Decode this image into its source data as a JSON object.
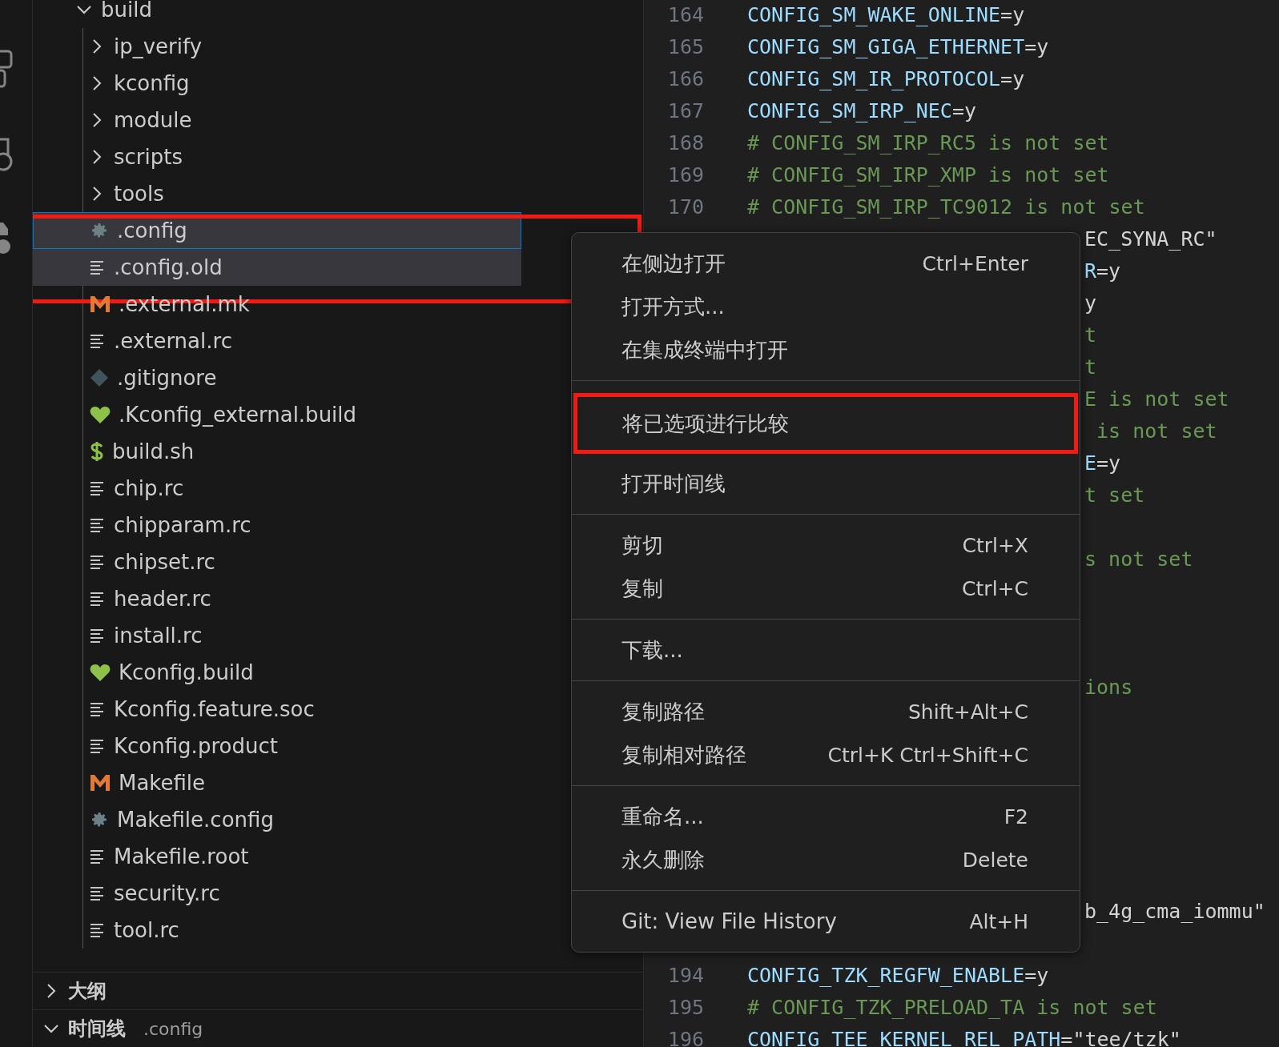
{
  "explorer": {
    "tree": [
      {
        "name": "build",
        "kind": "folder",
        "expanded": true,
        "selected": false,
        "focused": false,
        "children": [
          {
            "name": "ip_verify",
            "kind": "folder",
            "expanded": false,
            "selected": false,
            "focused": false
          },
          {
            "name": "kconfig",
            "kind": "folder",
            "expanded": false,
            "selected": false,
            "focused": false
          },
          {
            "name": "module",
            "kind": "folder",
            "expanded": false,
            "selected": false,
            "focused": false
          },
          {
            "name": "scripts",
            "kind": "folder",
            "expanded": false,
            "selected": false,
            "focused": false
          },
          {
            "name": "tools",
            "kind": "folder",
            "expanded": false,
            "selected": false,
            "focused": false
          },
          {
            "name": ".config",
            "kind": "settings",
            "selected": true,
            "focused": true,
            "marked": true
          },
          {
            "name": ".config.old",
            "kind": "text",
            "selected": true,
            "focused": false,
            "marked": true
          },
          {
            "name": ".external.mk",
            "kind": "makefile",
            "selected": false,
            "focused": false,
            "marked": false
          },
          {
            "name": ".external.rc",
            "kind": "text",
            "selected": false,
            "focused": false,
            "marked": false
          },
          {
            "name": ".gitignore",
            "kind": "git",
            "selected": false,
            "focused": false,
            "marked": false
          },
          {
            "name": ".Kconfig_external.build",
            "kind": "kconfig",
            "selected": false,
            "focused": false,
            "marked": false
          },
          {
            "name": "build.sh",
            "kind": "shell",
            "selected": false,
            "focused": false,
            "marked": false
          },
          {
            "name": "chip.rc",
            "kind": "text",
            "selected": false,
            "focused": false,
            "marked": false
          },
          {
            "name": "chipparam.rc",
            "kind": "text",
            "selected": false,
            "focused": false,
            "marked": false
          },
          {
            "name": "chipset.rc",
            "kind": "text",
            "selected": false,
            "focused": false,
            "marked": false
          },
          {
            "name": "header.rc",
            "kind": "text",
            "selected": false,
            "focused": false,
            "marked": false
          },
          {
            "name": "install.rc",
            "kind": "text",
            "selected": false,
            "focused": false,
            "marked": false
          },
          {
            "name": "Kconfig.build",
            "kind": "kconfig",
            "selected": false,
            "focused": false,
            "marked": false
          },
          {
            "name": "Kconfig.feature.soc",
            "kind": "text",
            "selected": false,
            "focused": false,
            "marked": false
          },
          {
            "name": "Kconfig.product",
            "kind": "text",
            "selected": false,
            "focused": false,
            "marked": false
          },
          {
            "name": "Makefile",
            "kind": "makefile",
            "selected": false,
            "focused": false,
            "marked": false
          },
          {
            "name": "Makefile.config",
            "kind": "settings",
            "selected": false,
            "focused": false,
            "marked": false
          },
          {
            "name": "Makefile.root",
            "kind": "text",
            "selected": false,
            "focused": false,
            "marked": false
          },
          {
            "name": "security.rc",
            "kind": "text",
            "selected": false,
            "focused": false,
            "marked": false
          },
          {
            "name": "tool.rc",
            "kind": "text",
            "selected": false,
            "focused": false,
            "marked": false
          }
        ]
      }
    ],
    "panels": [
      {
        "title": "大纲",
        "expanded": false
      },
      {
        "title": "时间线",
        "expanded": true,
        "description": ".config"
      }
    ]
  },
  "editor": {
    "lines": [
      {
        "kind": "full",
        "number": "164",
        "segments": [
          {
            "kind": "key",
            "text": "CONFIG_SM_WAKE_ONLINE"
          },
          {
            "kind": "value",
            "text": "=y"
          }
        ]
      },
      {
        "kind": "full",
        "number": "165",
        "segments": [
          {
            "kind": "key",
            "text": "CONFIG_SM_GIGA_ETHERNET"
          },
          {
            "kind": "value",
            "text": "=y"
          }
        ]
      },
      {
        "kind": "full",
        "number": "166",
        "segments": [
          {
            "kind": "key",
            "text": "CONFIG_SM_IR_PROTOCOL"
          },
          {
            "kind": "value",
            "text": "=y"
          }
        ]
      },
      {
        "kind": "full",
        "number": "167",
        "segments": [
          {
            "kind": "key",
            "text": "CONFIG_SM_IRP_NEC"
          },
          {
            "kind": "value",
            "text": "=y"
          }
        ]
      },
      {
        "kind": "full",
        "number": "168",
        "segments": [
          {
            "kind": "comment",
            "text": "# CONFIG_SM_IRP_RC5 is not set"
          }
        ]
      },
      {
        "kind": "full",
        "number": "169",
        "segments": [
          {
            "kind": "comment",
            "text": "# CONFIG_SM_IRP_XMP is not set"
          }
        ]
      },
      {
        "kind": "full",
        "number": "170",
        "segments": [
          {
            "kind": "comment",
            "text": "# CONFIG_SM_IRP_TC9012 is not set"
          }
        ]
      },
      {
        "kind": "partial",
        "segments": [
          {
            "kind": "value",
            "text": "EC_SYNA_RC\""
          }
        ]
      },
      {
        "kind": "partial",
        "segments": [
          {
            "kind": "key",
            "text": "R"
          },
          {
            "kind": "value",
            "text": "=y"
          }
        ]
      },
      {
        "kind": "partial",
        "segments": [
          {
            "kind": "value",
            "text": "y"
          }
        ]
      },
      {
        "kind": "partial",
        "segments": [
          {
            "kind": "comment",
            "text": "t"
          }
        ]
      },
      {
        "kind": "partial",
        "segments": [
          {
            "kind": "comment",
            "text": "t"
          }
        ]
      },
      {
        "kind": "partial",
        "segments": [
          {
            "kind": "comment",
            "text": "E is not set"
          }
        ]
      },
      {
        "kind": "partial",
        "segments": [
          {
            "kind": "comment",
            "text": " is not set"
          }
        ]
      },
      {
        "kind": "partial",
        "segments": [
          {
            "kind": "key",
            "text": "E"
          },
          {
            "kind": "value",
            "text": "=y"
          }
        ]
      },
      {
        "kind": "partial",
        "segments": [
          {
            "kind": "comment",
            "text": "t set"
          }
        ]
      },
      {
        "kind": "partial"
      },
      {
        "kind": "partial",
        "segments": [
          {
            "kind": "comment",
            "text": "s not set"
          }
        ]
      },
      {
        "kind": "partial"
      },
      {
        "kind": "partial"
      },
      {
        "kind": "partial"
      },
      {
        "kind": "partial",
        "segments": [
          {
            "kind": "comment",
            "text": "ions"
          }
        ]
      },
      {
        "kind": "partial"
      },
      {
        "kind": "partial"
      },
      {
        "kind": "partial"
      },
      {
        "kind": "partial"
      },
      {
        "kind": "partial"
      },
      {
        "kind": "partial"
      },
      {
        "kind": "partial",
        "segments": [
          {
            "kind": "value",
            "text": "b_4g_cma_iommu\""
          }
        ]
      },
      {
        "kind": "partial"
      },
      {
        "kind": "full",
        "number": "194",
        "segments": [
          {
            "kind": "key",
            "text": "CONFIG_TZK_REGFW_ENABLE"
          },
          {
            "kind": "value",
            "text": "=y"
          }
        ]
      },
      {
        "kind": "full",
        "number": "195",
        "segments": [
          {
            "kind": "comment",
            "text": "# CONFIG_TZK_PRELOAD_TA is not set"
          }
        ]
      },
      {
        "kind": "full",
        "number": "196",
        "segments": [
          {
            "kind": "key",
            "text": "CONFIG TEE KERNEL REL PATH"
          },
          {
            "kind": "value",
            "text": "=\"tee/tzk\""
          }
        ]
      }
    ]
  },
  "context_menu": {
    "groups": [
      [
        {
          "label": "在侧边打开",
          "shortcut": "Ctrl+Enter",
          "marked": false
        },
        {
          "label": "打开方式...",
          "marked": false
        },
        {
          "label": "在集成终端中打开",
          "marked": false
        }
      ],
      [
        {
          "label": "将已选项进行比较",
          "marked": true
        },
        {
          "label": "打开时间线",
          "marked": false
        }
      ],
      [
        {
          "label": "剪切",
          "shortcut": "Ctrl+X",
          "marked": false
        },
        {
          "label": "复制",
          "shortcut": "Ctrl+C",
          "marked": false
        }
      ],
      [
        {
          "label": "下载...",
          "marked": false
        }
      ],
      [
        {
          "label": "复制路径",
          "shortcut": "Shift+Alt+C",
          "marked": false
        },
        {
          "label": "复制相对路径",
          "shortcut": "Ctrl+K Ctrl+Shift+C",
          "marked": false
        }
      ],
      [
        {
          "label": "重命名...",
          "shortcut": "F2",
          "marked": false
        },
        {
          "label": "永久删除",
          "shortcut": "Delete",
          "marked": false
        }
      ],
      [
        {
          "label": "Git: View File History",
          "shortcut": "Alt+H",
          "marked": false
        }
      ]
    ]
  }
}
